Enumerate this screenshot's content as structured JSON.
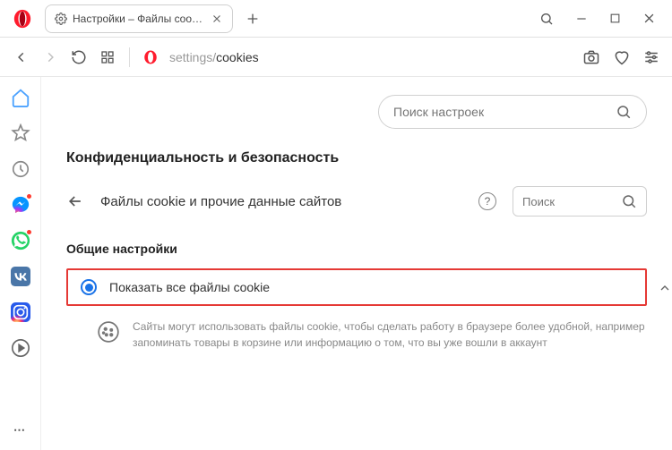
{
  "tab": {
    "title": "Настройки – Файлы cookie"
  },
  "address": {
    "prefix": "settings/",
    "path": "cookies"
  },
  "search": {
    "placeholder": "Поиск настроек"
  },
  "section": {
    "title": "Конфиденциальность и безопасность"
  },
  "sub": {
    "title": "Файлы cookie и прочие данные сайтов",
    "search_placeholder": "Поиск"
  },
  "general": {
    "label": "Общие настройки"
  },
  "option": {
    "label": "Показать все файлы cookie",
    "description": "Сайты могут использовать файлы cookie, чтобы сделать работу в браузере более удобной, например запоминать товары в корзине или информацию о том, что вы уже вошли в аккаунт"
  }
}
